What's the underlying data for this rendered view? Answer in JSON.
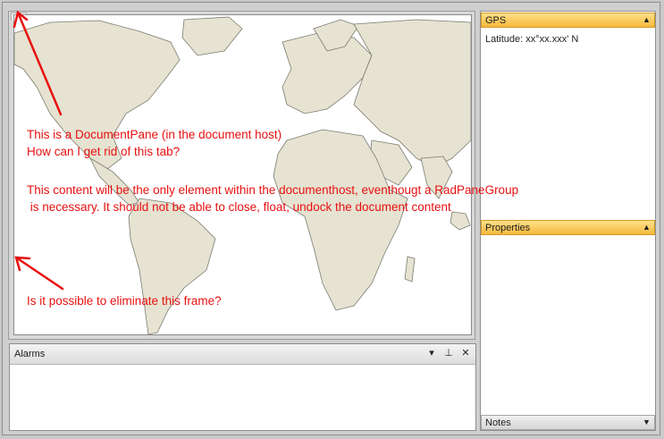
{
  "colors": {
    "accent_header": "#f6b93b",
    "annotation": "#e81010",
    "land": "#e6e3d2",
    "land_stroke": "#7b7b70"
  },
  "right_panes": {
    "gps": {
      "title": "GPS",
      "latitude_text": "Latitude: xx°xx.xxx' N",
      "icon": "chevron-up-icon"
    },
    "properties": {
      "title": "Properties",
      "icon": "chevron-up-icon"
    },
    "notes": {
      "title": "Notes",
      "icon": "chevron-down-icon"
    }
  },
  "alarms": {
    "title": "Alarms",
    "buttons": {
      "menu": "▾",
      "pin": "⊥",
      "close": "✕"
    }
  },
  "annotations": {
    "doc_pane_note": "This is a DocumentPane (in the document host)\nHow can I get rid of this tab?",
    "content_note": "This content will be the only element within the documenthost, eventhougt a RadPaneGroup\n is necessary. It should not be able to close, float, undock the document content",
    "frame_note": "Is it possible to eliminate this frame?"
  }
}
